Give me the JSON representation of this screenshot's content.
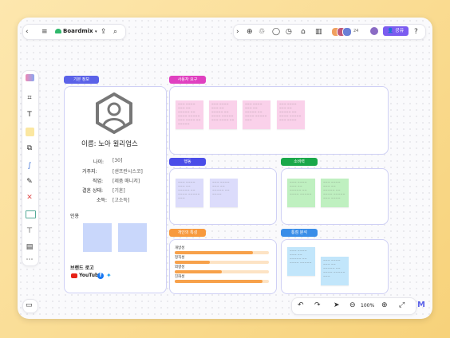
{
  "app": {
    "name": "Boardmix"
  },
  "topbar": {
    "share_label": "공유",
    "zoom": "100%",
    "avatar_count": "24"
  },
  "profile": {
    "frame_label": "기본 정보",
    "name": "이름: 노아 윌리엄스",
    "fields": [
      {
        "label": "나이:",
        "value": "[30]"
      },
      {
        "label": "거주지:",
        "value": "[샌프란시스코]"
      },
      {
        "label": "직업:",
        "value": "[제품 매니저]"
      },
      {
        "label": "결혼 상태:",
        "value": "[기혼]"
      },
      {
        "label": "소득:",
        "value": "[고소득]"
      }
    ],
    "quotes_label": "인용",
    "brand_logo_label": "브랜드 로고",
    "brands": [
      "YouTube"
    ]
  },
  "frames": {
    "needs": {
      "label": "사용자 요구"
    },
    "behavior": {
      "label": "행동"
    },
    "consumption": {
      "label": "소비력"
    },
    "personality": {
      "label": "개인의 특성"
    },
    "pain": {
      "label": "통점 분석"
    }
  },
  "personality_bars": [
    {
      "label": "개방성",
      "value": 0.83
    },
    {
      "label": "정직성",
      "value": 0.37
    },
    {
      "label": "외향성",
      "value": 0.5
    },
    {
      "label": "친화성",
      "value": 0.93
    }
  ],
  "colors": {
    "accent": "#7b5cf0",
    "orange": "#f7a14a",
    "pink": "#fad1ea",
    "lavender": "#dcdcfb",
    "green": "#bff0c0",
    "blue": "#c2e6fb"
  }
}
